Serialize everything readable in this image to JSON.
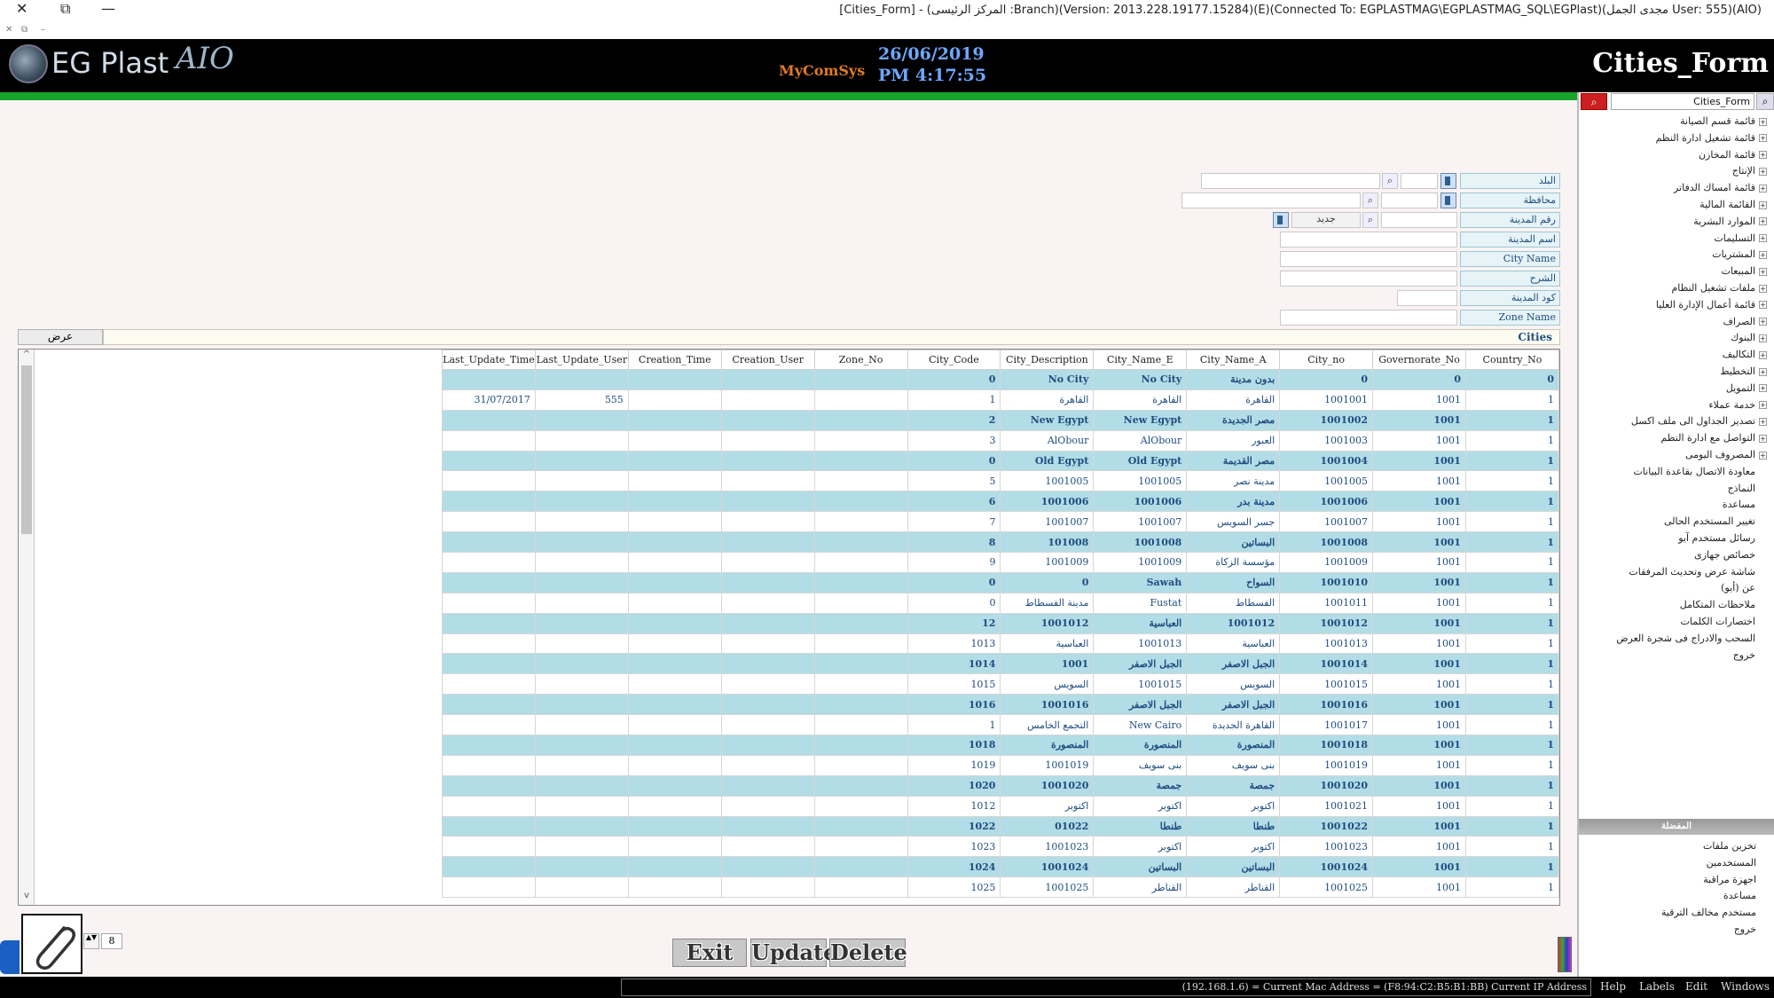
{
  "window": {
    "title": "[Cities_Form] - (المركز الرئيسى :Branch)(Version: 2013.228.19177.15284)(E)(Connected To: EGPLASTMAG\\EGPLASTMAG_SQL\\EGPlast)(مجدى الجمل User: 555)(AIO)",
    "close_glyph": "✕",
    "restore_glyph": "⧉",
    "minimize_glyph": "—",
    "mini_close": "✕",
    "mini_restore": "⧉",
    "mini_min": "–"
  },
  "header": {
    "logo_text": "EG Plast",
    "logo_aio": "AIO",
    "mycom": "MyComSys",
    "date": "26/06/2019",
    "time": "PM 4:17:55",
    "form_title": "Cities_Form"
  },
  "form": {
    "country_label": "البلد",
    "governorate_label": "محافظة",
    "city_no_label": "رقم المدينة",
    "city_name_a_label": "اسم المدينة",
    "city_name_e_label": "City Name",
    "description_label": "الشرح",
    "city_code_label": "كود المدينة",
    "zone_name_label": "Zone Name",
    "new_label": "جديد",
    "search_glyph": "⌕",
    "zone_bar": "Cities",
    "view_button": "عرض"
  },
  "grid": {
    "columns": [
      "Last_Update_Time",
      "Last_Update_User",
      "Creation_Time",
      "Creation_User",
      "Zone_No",
      "City_Code",
      "City_Description",
      "City_Name_E",
      "City_Name_A",
      "City_no",
      "Governorate_No",
      "Country_No"
    ],
    "rows": [
      [
        "",
        "",
        "",
        "",
        "",
        "0",
        "No City",
        "No City",
        "بدون مدينة",
        "0",
        "0",
        "0"
      ],
      [
        "31/07/2017",
        "555",
        "",
        "",
        "",
        "1",
        "القاهرة",
        "القاهرة",
        "القاهرة",
        "1001001",
        "1001",
        "1"
      ],
      [
        "",
        "",
        "",
        "",
        "",
        "2",
        "New Egypt",
        "New Egypt",
        "مصر الجديدة",
        "1001002",
        "1001",
        "1"
      ],
      [
        "",
        "",
        "",
        "",
        "",
        "3",
        "AlObour",
        "AlObour",
        "العبور",
        "1001003",
        "1001",
        "1"
      ],
      [
        "",
        "",
        "",
        "",
        "",
        "0",
        "Old Egypt",
        "Old Egypt",
        "مصر القديمة",
        "1001004",
        "1001",
        "1"
      ],
      [
        "",
        "",
        "",
        "",
        "",
        "5",
        "1001005",
        "1001005",
        "مدينة نصر",
        "1001005",
        "1001",
        "1"
      ],
      [
        "",
        "",
        "",
        "",
        "",
        "6",
        "1001006",
        "1001006",
        "مدينة بدر",
        "1001006",
        "1001",
        "1"
      ],
      [
        "",
        "",
        "",
        "",
        "",
        "7",
        "1001007",
        "1001007",
        "جسر السويس",
        "1001007",
        "1001",
        "1"
      ],
      [
        "",
        "",
        "",
        "",
        "",
        "8",
        "101008",
        "1001008",
        "البساتين",
        "1001008",
        "1001",
        "1"
      ],
      [
        "",
        "",
        "",
        "",
        "",
        "9",
        "1001009",
        "1001009",
        "مؤسسة الزكاة",
        "1001009",
        "1001",
        "1"
      ],
      [
        "",
        "",
        "",
        "",
        "",
        "0",
        "0",
        "Sawah",
        "السواح",
        "1001010",
        "1001",
        "1"
      ],
      [
        "",
        "",
        "",
        "",
        "",
        "0",
        "مدينة الفسطاط",
        "Fustat",
        "الفسطاط",
        "1001011",
        "1001",
        "1"
      ],
      [
        "",
        "",
        "",
        "",
        "",
        "12",
        "1001012",
        "العباسية",
        "1001012",
        "1001012",
        "1001",
        "1"
      ],
      [
        "",
        "",
        "",
        "",
        "",
        "1013",
        "العباسية",
        "1001013",
        "العباسية",
        "1001013",
        "1001",
        "1"
      ],
      [
        "",
        "",
        "",
        "",
        "",
        "1014",
        "1001",
        "الجبل الاصفر",
        "الجبل الاصفر",
        "1001014",
        "1001",
        "1"
      ],
      [
        "",
        "",
        "",
        "",
        "",
        "1015",
        "السويس",
        "1001015",
        "السويس",
        "1001015",
        "1001",
        "1"
      ],
      [
        "",
        "",
        "",
        "",
        "",
        "1016",
        "1001016",
        "الجبل الاصفر",
        "الجبل الاصفر",
        "1001016",
        "1001",
        "1"
      ],
      [
        "",
        "",
        "",
        "",
        "",
        "1",
        "التجمع الخامس",
        "New Cairo",
        "القاهرة الجديدة",
        "1001017",
        "1001",
        "1"
      ],
      [
        "",
        "",
        "",
        "",
        "",
        "1018",
        "المنصورة",
        "المنصورة",
        "المنصورة",
        "1001018",
        "1001",
        "1"
      ],
      [
        "",
        "",
        "",
        "",
        "",
        "1019",
        "1001019",
        "بنى سويف",
        "بنى سويف",
        "1001019",
        "1001",
        "1"
      ],
      [
        "",
        "",
        "",
        "",
        "",
        "1020",
        "1001020",
        "جمصة",
        "جمصة",
        "1001020",
        "1001",
        "1"
      ],
      [
        "",
        "",
        "",
        "",
        "",
        "1012",
        "اكتوبر",
        "اكتوبر",
        "اكتوبر",
        "1001021",
        "1001",
        "1"
      ],
      [
        "",
        "",
        "",
        "",
        "",
        "1022",
        "01022",
        "طنطا",
        "طنطا",
        "1001022",
        "1001",
        "1"
      ],
      [
        "",
        "",
        "",
        "",
        "",
        "1023",
        "1001023",
        "اكتوبر",
        "اكتوبر",
        "1001023",
        "1001",
        "1"
      ],
      [
        "",
        "",
        "",
        "",
        "",
        "1024",
        "1001024",
        "البساتين",
        "البساتين",
        "1001024",
        "1001",
        "1"
      ],
      [
        "",
        "",
        "",
        "",
        "",
        "1025",
        "1001025",
        "القناطر",
        "القناطر",
        "1001025",
        "1001",
        "1"
      ]
    ],
    "scroll_up": "^",
    "scroll_down": "v"
  },
  "rightpanel": {
    "search_value": "Cities_Form",
    "search_glyph": "⌕",
    "tree": [
      {
        "label": "قائمة قسم الصيانة",
        "expand": true
      },
      {
        "label": "قائمة تشغيل ادارة النظم",
        "expand": true
      },
      {
        "label": "قائمة المخازن",
        "expand": true
      },
      {
        "label": "الإنتاج",
        "expand": true
      },
      {
        "label": "قائمة امساك الدفاتر",
        "expand": true
      },
      {
        "label": "القائمة المالية",
        "expand": true
      },
      {
        "label": "الموارد البشرية",
        "expand": true
      },
      {
        "label": "التسليمات",
        "expand": true
      },
      {
        "label": "المشتريات",
        "expand": true
      },
      {
        "label": "المبيعات",
        "expand": true
      },
      {
        "label": "ملفات تشغيل النظام",
        "expand": true
      },
      {
        "label": "قائمة أعمال الإدارة العليا",
        "expand": true
      },
      {
        "label": "الصراف",
        "expand": true
      },
      {
        "label": "البنوك",
        "expand": true
      },
      {
        "label": "التكاليف",
        "expand": true
      },
      {
        "label": "التخطيط",
        "expand": true
      },
      {
        "label": "التمويل",
        "expand": true
      },
      {
        "label": "خدمة عملاء",
        "expand": true
      },
      {
        "label": "تصدير الجداول الى ملف اكسل",
        "expand": true
      },
      {
        "label": "التواصل مع ادارة النظم",
        "expand": true
      },
      {
        "label": "المصروف اليومى",
        "expand": true
      },
      {
        "label": "معاودة الاتصال بقاعدة البيانات",
        "expand": false
      },
      {
        "label": "النماذج",
        "expand": false
      },
      {
        "label": "مساعدة",
        "expand": false
      },
      {
        "label": "تغيير المستخدم الحالى",
        "expand": false
      },
      {
        "label": "رسائل مستخدم آيو",
        "expand": false
      },
      {
        "label": "خصائص جهازى",
        "expand": false
      },
      {
        "label": "شاشة عرض وتحديث المرفقات",
        "expand": false
      },
      {
        "label": "عن (أيو)",
        "expand": false
      },
      {
        "label": "ملاحظات المتكامل",
        "expand": false
      },
      {
        "label": "اختصارات الكلمات",
        "expand": false
      },
      {
        "label": "السحب والادراج فى شجرة العرض",
        "expand": false
      },
      {
        "label": "خروج",
        "expand": false
      }
    ],
    "sep_label": "المفضلة",
    "fav": [
      "تخزين ملفات",
      "المستخدمين",
      "اجهزة مراقبة",
      "مساعدة",
      "مستخدم مخالف الترقية",
      "خروج"
    ]
  },
  "bottom": {
    "ip_text": "(192.168.1.6) = Current Mac Address = (F8:94:C2:B5:B1:BB) Current IP Address",
    "menus": [
      "Help",
      "Labels",
      "Edit",
      "Windows"
    ],
    "spin_value": "8",
    "spin_glyph": "▲▼",
    "buttons": {
      "exit": "Exit",
      "update": "Update",
      "delete": "Delete"
    }
  }
}
